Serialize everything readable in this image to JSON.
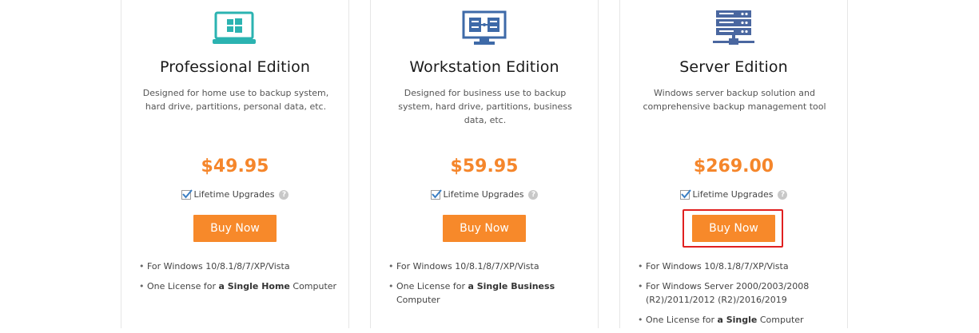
{
  "colors": {
    "accent": "#f7892a",
    "price": "#f5862b",
    "icon_professional": "#2bb3b1",
    "icon_workstation": "#3e6aa8",
    "icon_server": "#4a67a0",
    "highlight_border": "#e02020"
  },
  "editions": [
    {
      "icon": "laptop-windows-icon",
      "title": "Professional Edition",
      "description": "Designed for home use to backup system, hard drive, partitions, personal data, etc.",
      "price": "$49.95",
      "lifetime_label": "Lifetime Upgrades",
      "lifetime_checked": true,
      "buy_label": "Buy Now",
      "features": [
        {
          "pre": "For Windows 10/8.1/8/7/XP/Vista",
          "bold": "",
          "post": ""
        },
        {
          "pre": "One License for ",
          "bold": "a Single Home",
          "post": " Computer"
        }
      ]
    },
    {
      "icon": "monitor-network-icon",
      "title": "Workstation Edition",
      "description": "Designed for business use to backup system, hard drive, partitions, business data, etc.",
      "price": "$59.95",
      "lifetime_label": "Lifetime Upgrades",
      "lifetime_checked": true,
      "buy_label": "Buy Now",
      "features": [
        {
          "pre": "For Windows 10/8.1/8/7/XP/Vista",
          "bold": "",
          "post": ""
        },
        {
          "pre": "One License for ",
          "bold": "a Single Business",
          "post": " Computer"
        }
      ]
    },
    {
      "icon": "server-rack-icon",
      "title": "Server Edition",
      "description": "Windows server backup solution and comprehensive backup management tool",
      "price": "$269.00",
      "lifetime_label": "Lifetime Upgrades",
      "lifetime_checked": true,
      "buy_label": "Buy Now",
      "features": [
        {
          "pre": "For Windows 10/8.1/8/7/XP/Vista",
          "bold": "",
          "post": ""
        },
        {
          "pre": "For Windows Server 2000/2003/2008 (R2)/2011/2012 (R2)/2016/2019",
          "bold": "",
          "post": ""
        },
        {
          "pre": "One License for ",
          "bold": "a Single",
          "post": " Computer"
        }
      ]
    }
  ]
}
